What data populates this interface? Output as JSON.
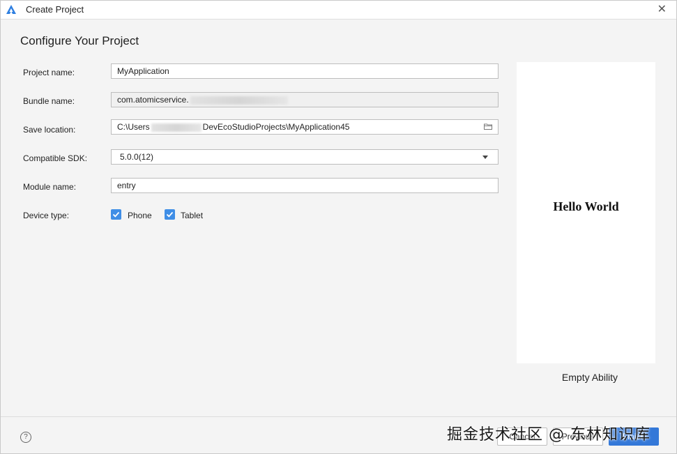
{
  "window": {
    "title": "Create Project"
  },
  "page": {
    "heading": "Configure Your Project"
  },
  "form": {
    "project_name": {
      "label": "Project name:",
      "value": "MyApplication"
    },
    "bundle_name": {
      "label": "Bundle name:",
      "value": "com.atomicservice."
    },
    "save_location": {
      "label": "Save location:",
      "prefix": "C:\\Users",
      "suffix": "DevEcoStudioProjects\\MyApplication45"
    },
    "compatible_sdk": {
      "label": "Compatible SDK:",
      "value": "5.0.0(12)"
    },
    "module_name": {
      "label": "Module name:",
      "value": "entry"
    },
    "device_type": {
      "label": "Device type:",
      "options": [
        {
          "label": "Phone",
          "checked": true
        },
        {
          "label": "Tablet",
          "checked": true
        }
      ]
    }
  },
  "preview": {
    "text": "Hello World",
    "caption": "Empty Ability"
  },
  "footer": {
    "help_icon": "?",
    "cancel_label": "Cancel",
    "previous_label": "Previous",
    "finish_label": "Finish"
  },
  "watermark": "掘金技术社区 @ 东林知识库",
  "colors": {
    "accent": "#3f8ee6",
    "primary_button": "#3478d8"
  }
}
